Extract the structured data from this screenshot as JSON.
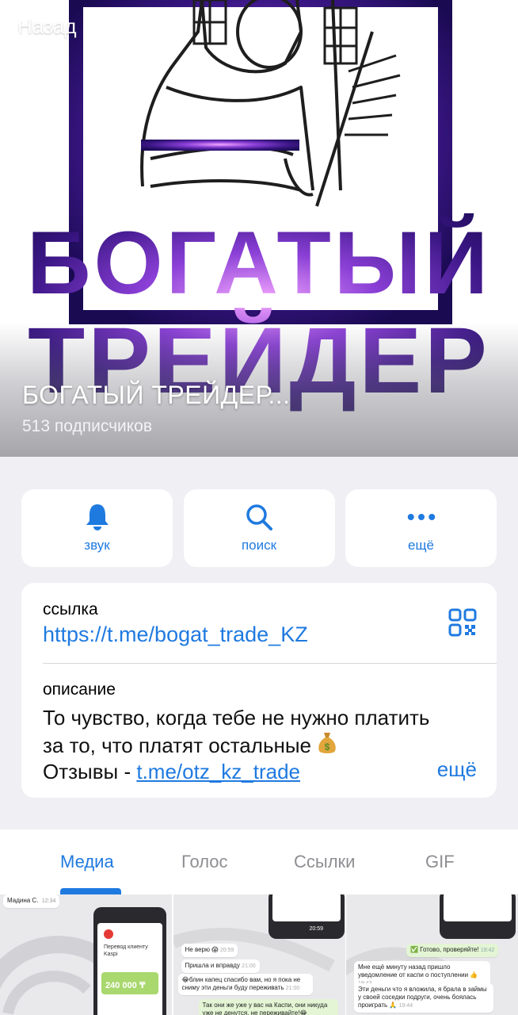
{
  "header": {
    "back_label": "Назад",
    "logo_line1": "БОГАТЫЙ",
    "logo_line2": "ТРЕЙДЕР",
    "channel_title": "БОГАТЫЙ ТРЕЙДЕР...",
    "subscribers": "513 подписчиков"
  },
  "actions": [
    {
      "label": "звук",
      "icon": "bell-icon"
    },
    {
      "label": "поиск",
      "icon": "search-icon"
    },
    {
      "label": "ещё",
      "icon": "more-dots-icon"
    }
  ],
  "info": {
    "link_label": "ссылка",
    "link_url": "https://t.me/bogat_trade_KZ",
    "description_label": "описание",
    "description_line1": "То чувство, когда тебе не нужно платить",
    "description_line2": "за то, что платят остальные",
    "description_line3_prefix": "Отзывы - ",
    "description_link": "t.me/otz_kz_trade",
    "more_label": "ещё"
  },
  "tabs": [
    {
      "label": "Медиа",
      "active": true
    },
    {
      "label": "Голос",
      "active": false
    },
    {
      "label": "Ссылки",
      "active": false
    },
    {
      "label": "GIF",
      "active": false
    }
  ],
  "media": {
    "thumb1": {
      "name": "Мадина С.",
      "time": "12:34",
      "title": "Перевод клиенту Kaspi",
      "amount": "240 000 ₸"
    },
    "thumb2": {
      "msg1": "Не верю 😱",
      "msg1_time": "20:59",
      "msg2": "Пришла и вправду",
      "msg2_time": "21:00",
      "msg3": "😂блин капец спасибо вам, но я пока не сниму эти деньги буду переживать",
      "msg3_time": "21:00",
      "msg4": "Так они же уже у вас на Каспи, они никуда уже не денутся, не переживайте!😂",
      "time_top": "20:59"
    },
    "thumb3": {
      "msg1": "✅ Готово, проверяйте!",
      "msg1_time": "19:42",
      "msg2": "Мне ещё минуту назад пришло уведомление от каспи о поступлении 👍",
      "msg2_time": "19:43",
      "msg3": "Эти деньги что я вложила, я брала в займы у своей соседки подруги, очень боялась проиграть 🙏",
      "msg3_time": "19:44"
    }
  },
  "colors": {
    "accent": "#1f7ae0",
    "background": "#efeff4",
    "logo_purple": "#5a1fa0"
  }
}
